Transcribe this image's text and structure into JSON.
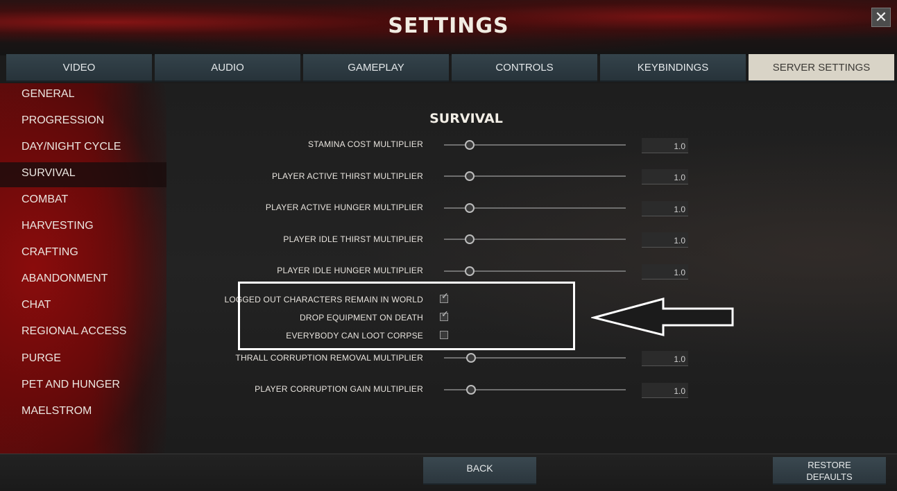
{
  "header": {
    "title": "SETTINGS",
    "close_label": "✕"
  },
  "tabs": [
    {
      "label": "VIDEO"
    },
    {
      "label": "AUDIO"
    },
    {
      "label": "GAMEPLAY"
    },
    {
      "label": "CONTROLS"
    },
    {
      "label": "KEYBINDINGS"
    },
    {
      "label": "SERVER SETTINGS",
      "active": true
    }
  ],
  "sidebar": {
    "items": [
      {
        "label": "GENERAL"
      },
      {
        "label": "PROGRESSION"
      },
      {
        "label": "DAY/NIGHT CYCLE"
      },
      {
        "label": "SURVIVAL",
        "active": true
      },
      {
        "label": "COMBAT"
      },
      {
        "label": "HARVESTING"
      },
      {
        "label": "CRAFTING"
      },
      {
        "label": "ABANDONMENT"
      },
      {
        "label": "CHAT"
      },
      {
        "label": "REGIONAL ACCESS"
      },
      {
        "label": "PURGE"
      },
      {
        "label": "PET AND HUNGER"
      },
      {
        "label": "MAELSTROM"
      }
    ]
  },
  "main": {
    "section_title": "SURVIVAL",
    "sliders": [
      {
        "label": "STAMINA COST MULTIPLIER",
        "value": "1.0",
        "fraction": 0.14
      },
      {
        "label": "PLAYER ACTIVE THIRST MULTIPLIER",
        "value": "1.0",
        "fraction": 0.14
      },
      {
        "label": "PLAYER ACTIVE HUNGER MULTIPLIER",
        "value": "1.0",
        "fraction": 0.14
      },
      {
        "label": "PLAYER IDLE THIRST MULTIPLIER",
        "value": "1.0",
        "fraction": 0.14
      },
      {
        "label": "PLAYER IDLE HUNGER MULTIPLIER",
        "value": "1.0",
        "fraction": 0.14
      },
      {
        "label": "THRALL CORRUPTION REMOVAL MULTIPLIER",
        "value": "1.0",
        "fraction": 0.15
      },
      {
        "label": "PLAYER CORRUPTION GAIN MULTIPLIER",
        "value": "1.0",
        "fraction": 0.15
      }
    ],
    "checkboxes": [
      {
        "label": "LOGGED OUT CHARACTERS REMAIN IN WORLD",
        "checked": true
      },
      {
        "label": "DROP EQUIPMENT ON DEATH",
        "checked": true
      },
      {
        "label": "EVERYBODY CAN LOOT CORPSE",
        "checked": false
      }
    ]
  },
  "footer": {
    "back_label": "BACK",
    "restore_line1": "RESTORE",
    "restore_line2": "DEFAULTS"
  },
  "colors": {
    "accent_red": "#8c0c0c",
    "tab_bg": "#2f3d45",
    "tab_active_bg": "#d9d4c7",
    "highlight": "#ffffff"
  }
}
